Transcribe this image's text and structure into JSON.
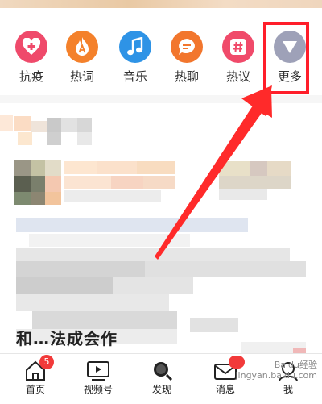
{
  "quick_entries": [
    {
      "label": "抗疫",
      "icon": "heart-plus-icon",
      "color": "#ef4a6b"
    },
    {
      "label": "热词",
      "icon": "flame-a-icon",
      "color": "#f4812b"
    },
    {
      "label": "音乐",
      "icon": "music-note-icon",
      "color": "#2e93e6"
    },
    {
      "label": "热聊",
      "icon": "chat-bubble-icon",
      "color": "#f2762d"
    },
    {
      "label": "热议",
      "icon": "hashtag-icon",
      "color": "#f04a6a"
    },
    {
      "label": "更多",
      "icon": "triangle-down-icon",
      "color": "#9ea1b8"
    }
  ],
  "feed": {
    "partial_text": "和…法成会作"
  },
  "tabbar": {
    "items": [
      {
        "label": "首页",
        "icon": "home-icon",
        "badge": "5"
      },
      {
        "label": "视频号",
        "icon": "video-icon"
      },
      {
        "label": "发现",
        "icon": "discover-icon"
      },
      {
        "label": "消息",
        "icon": "message-icon"
      },
      {
        "label": "我",
        "icon": "profile-icon"
      }
    ]
  },
  "watermark": {
    "line1": "Baidu经验",
    "line2": "jingyan.baidu.com"
  },
  "colors": {
    "highlight": "#ff1e2a",
    "arrow": "#ff2a2a"
  }
}
